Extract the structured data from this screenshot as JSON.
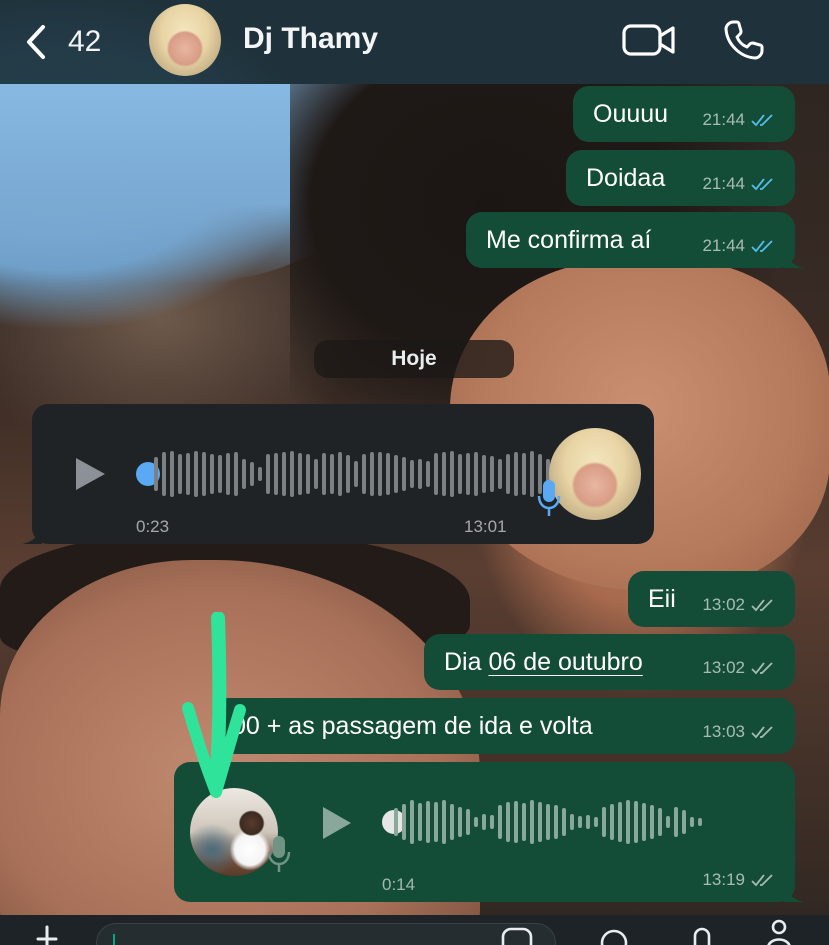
{
  "header": {
    "back_count": "42",
    "contact_name": "Dj Thamy",
    "icons": [
      "back-chevron-icon",
      "video-call-icon",
      "voice-call-icon"
    ]
  },
  "date_separator": "Hoje",
  "messages": [
    {
      "direction": "out",
      "text": "Ouuuu",
      "time": "21:44",
      "status": "read"
    },
    {
      "direction": "out",
      "text": "Doidaa",
      "time": "21:44",
      "status": "read"
    },
    {
      "direction": "out",
      "text": "Me confirma aí",
      "time": "21:44",
      "status": "read"
    },
    {
      "direction": "in",
      "type": "voice",
      "duration": "0:23",
      "time": "13:01",
      "progress": 0
    },
    {
      "direction": "out",
      "text": "Eii",
      "time": "13:02",
      "status": "delivered"
    },
    {
      "direction": "out",
      "text_prefix": "Dia ",
      "link_text": "06 de outubro",
      "time": "13:02",
      "status": "delivered"
    },
    {
      "direction": "out",
      "text": "00 + as passagem de ida e volta",
      "time": "13:03",
      "status": "delivered"
    },
    {
      "direction": "out",
      "type": "voice",
      "duration": "0:14",
      "time": "13:19",
      "status": "delivered",
      "progress": 0
    }
  ],
  "annotation": {
    "type": "arrow",
    "color": "#2fe39a"
  },
  "colors": {
    "header_bg": "#1e343e",
    "outgoing_bubble": "#144d37",
    "incoming_bubble": "#1f2325",
    "read_ticks": "#53bdeb",
    "voice_dot_incoming": "#5aa9f5"
  }
}
